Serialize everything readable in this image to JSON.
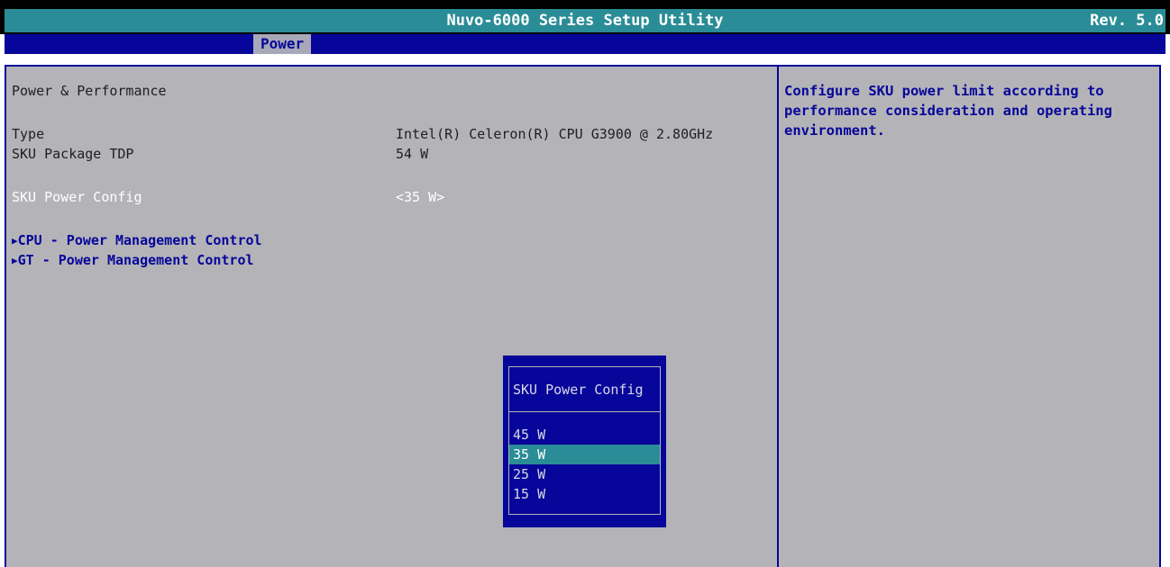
{
  "header": {
    "title": "Nuvo-6000 Series Setup Utility",
    "revision": "Rev. 5.0"
  },
  "menu": {
    "tabs": [
      {
        "label": "Power",
        "active": true
      }
    ]
  },
  "main": {
    "section_title": "Power & Performance",
    "type_label": "Type",
    "type_value": "Intel(R) Celeron(R) CPU G3900 @ 2.80GHz",
    "tdp_label": "SKU Package TDP",
    "tdp_value": "54 W",
    "power_config_label": "SKU Power Config",
    "power_config_value": "<35 W>",
    "submenus": [
      {
        "label": "CPU - Power Management Control"
      },
      {
        "label": "GT - Power Management Control"
      }
    ]
  },
  "help": {
    "text": "Configure SKU power limit according to\nperformance consideration and operating\nenvironment."
  },
  "popup": {
    "title": "SKU Power Config",
    "options": [
      "45 W",
      "35 W",
      "25 W",
      "15 W"
    ],
    "selected": "35 W"
  },
  "colors": {
    "accent": "#2a8c96",
    "navy": "#07069a",
    "panel": "#b4b4b8"
  }
}
